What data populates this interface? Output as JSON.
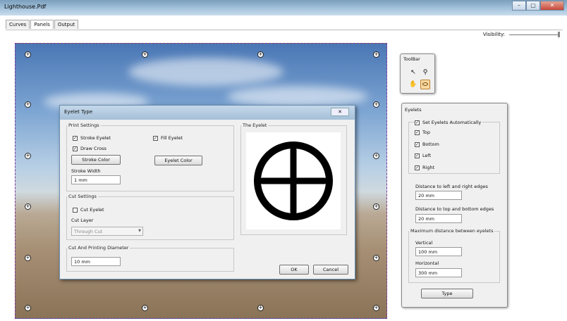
{
  "window": {
    "title": "Lighthouse.Pdf",
    "buttons": [
      "–",
      "▢",
      "✕"
    ]
  },
  "tabs": [
    {
      "label": "Curves"
    },
    {
      "label": "Panels",
      "active": true
    },
    {
      "label": "Output"
    }
  ],
  "visibility": {
    "label": "Visibility:"
  },
  "dialog": {
    "title": "Eyelet Type",
    "close": "✕",
    "print_settings": {
      "legend": "Print Settings",
      "stroke_eyelet": "Stroke Eyelet",
      "fill_eyelet": "Fill Eyelet",
      "draw_cross": "Draw Cross",
      "stroke_color_btn": "Stroke Color",
      "eyelet_color_btn": "Eyelet Color",
      "stroke_width_label": "Stroke Width",
      "stroke_width_value": "1 mm"
    },
    "cut_settings": {
      "legend": "Cut Settings",
      "cut_eyelet": "Cut Eyelet",
      "cut_layer_label": "Cut Layer",
      "cut_layer_value": "Through Cut"
    },
    "diameter": {
      "legend": "Cut And Printing Diameter",
      "value": "10 mm"
    },
    "preview": {
      "legend": "The Eyelet"
    },
    "ok": "OK",
    "cancel": "Cancel"
  },
  "toolbar": {
    "title": "ToolBar"
  },
  "eyelets": {
    "title": "Eyelets",
    "auto": "Set Eyelets Automatically",
    "top": "Top",
    "bottom": "Bottom",
    "left": "Left",
    "right": "Right",
    "lr_label": "Distance to left and right edges",
    "lr_value": "20 mm",
    "tb_label": "Distance to top and bottom edges",
    "tb_value": "20 mm",
    "max_legend": "Maximum distance between eyelets",
    "vertical_label": "Vertical",
    "vertical_value": "100 mm",
    "horizontal_label": "Horizontal",
    "horizontal_value": "300 mm",
    "type_btn": "Type"
  }
}
